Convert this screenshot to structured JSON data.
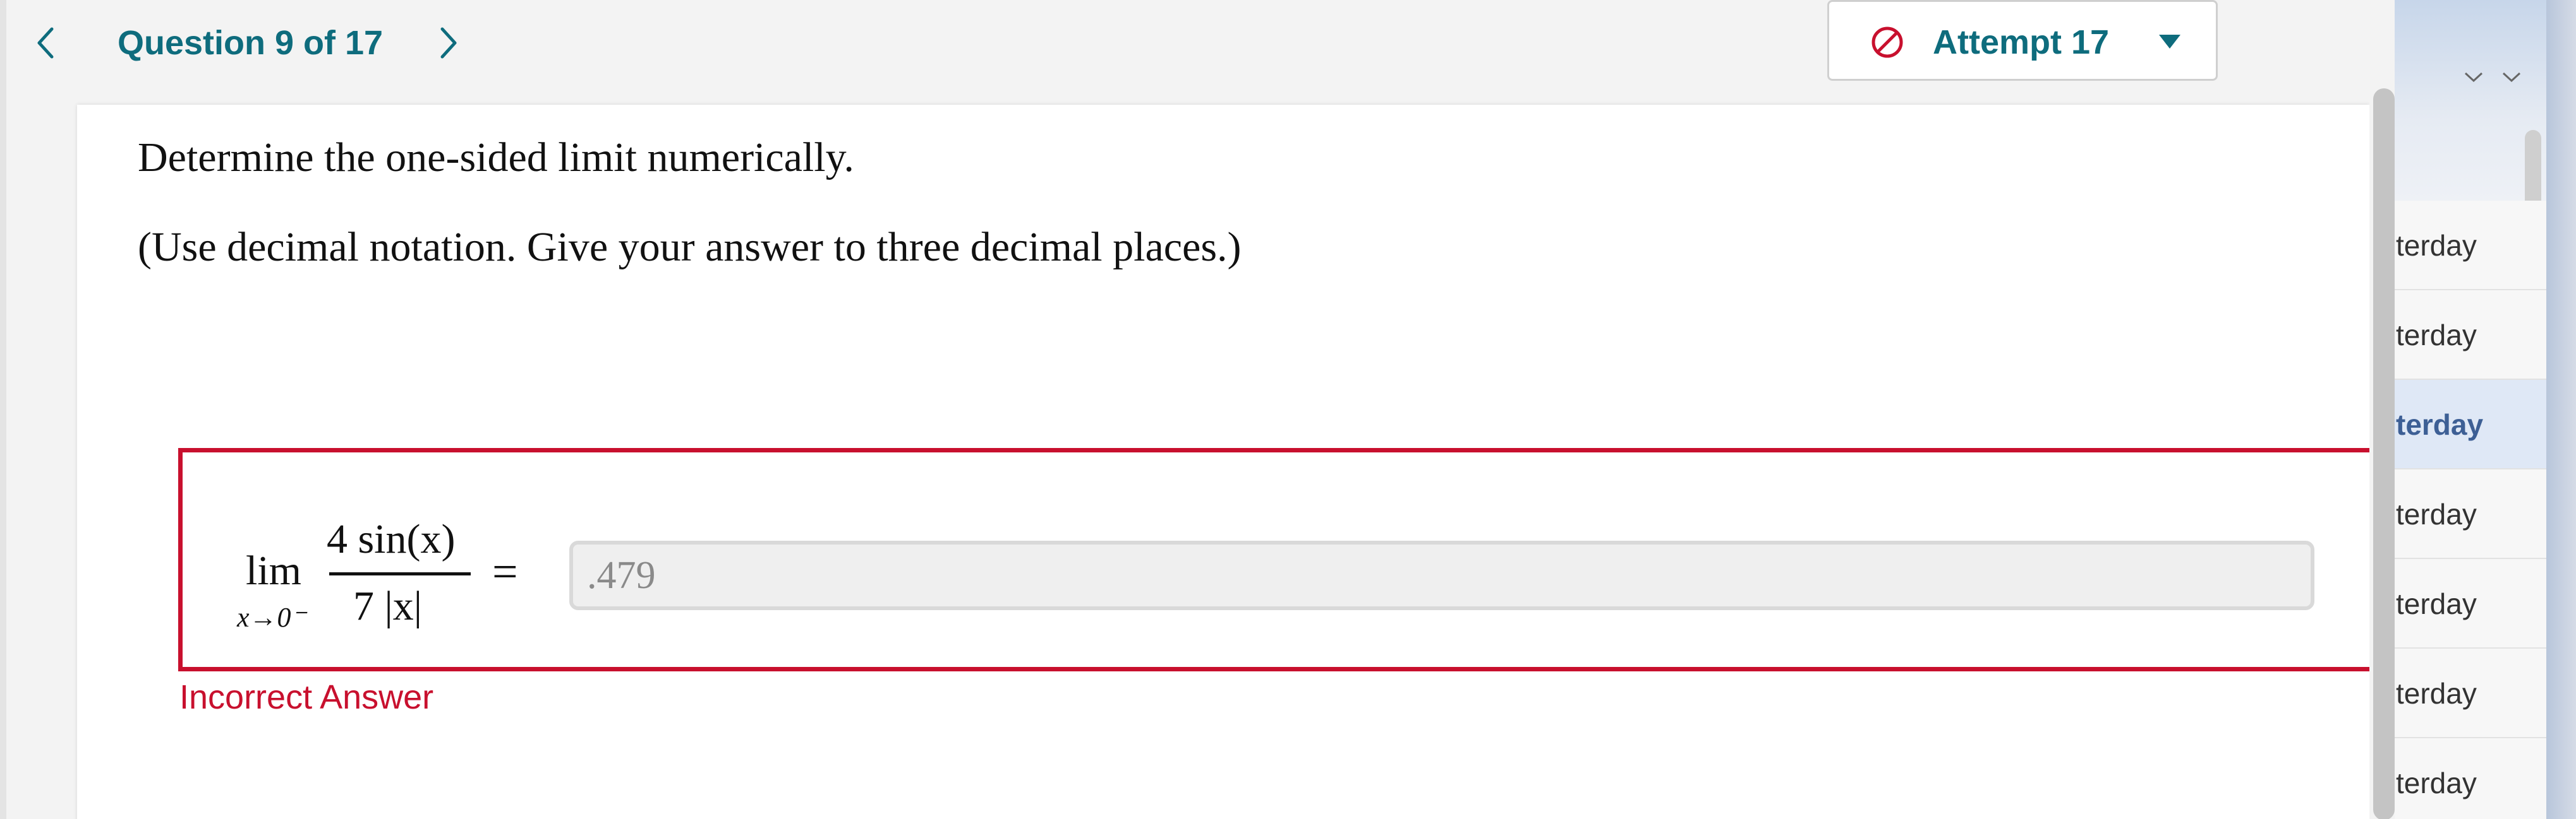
{
  "header": {
    "question_counter": "Question 9 of 17",
    "prev_icon": "chevron-left-icon",
    "next_icon": "chevron-right-icon",
    "attempt_label": "Attempt 17",
    "attempt_icon": "block-icon",
    "attempt_caret_icon": "caret-down-icon"
  },
  "question": {
    "prompt": "Determine the one-sided limit numerically.",
    "instructions": "(Use decimal notation. Give your answer to three decimal places.)",
    "math": {
      "lim": "lim",
      "subscript": "x→0⁻",
      "numerator": "4 sin(x)",
      "denominator": "7 |x|",
      "equals": "="
    },
    "answer_value": ".479",
    "feedback": "Incorrect Answer"
  },
  "colors": {
    "accent": "#0e6c7d",
    "error": "#c8102e"
  },
  "background_app": {
    "list_items": [
      "terday",
      "terday",
      "terday",
      "terday",
      "terday",
      "terday",
      "terday"
    ],
    "selected_index": 2
  }
}
